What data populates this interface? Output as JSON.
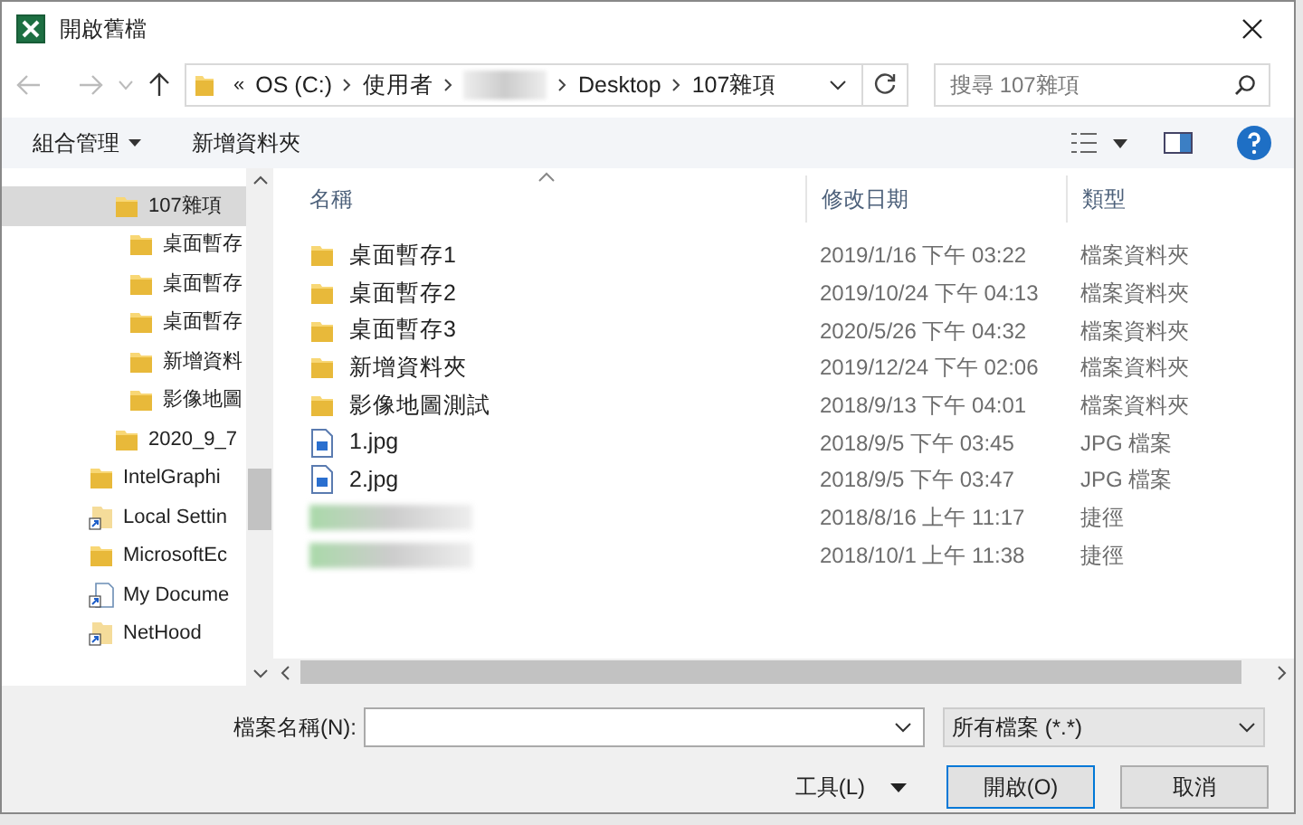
{
  "window": {
    "title": "開啟舊檔"
  },
  "address_bar": {
    "overflow": "«",
    "crumbs": [
      {
        "label": "OS (C:)",
        "kind": "text"
      },
      {
        "label": "使用者",
        "kind": "text"
      },
      {
        "kind": "blurred"
      },
      {
        "label": "Desktop",
        "kind": "text"
      },
      {
        "label": "107雜項",
        "kind": "text"
      }
    ]
  },
  "search": {
    "placeholder": "搜尋 107雜項"
  },
  "toolbar": {
    "organize": "組合管理",
    "new_folder": "新增資料夾"
  },
  "sidebar": {
    "desktop_items": [
      {
        "label": "107雜項",
        "kind": "folder",
        "selected": true,
        "children": [
          {
            "label": "桌面暫存",
            "kind": "folder",
            "selected": false
          },
          {
            "label": "桌面暫存",
            "kind": "folder",
            "selected": false
          },
          {
            "label": "桌面暫存",
            "kind": "folder",
            "selected": false
          },
          {
            "label": "新增資料",
            "kind": "folder",
            "selected": false
          },
          {
            "label": "影像地圖",
            "kind": "folder",
            "selected": false
          }
        ]
      },
      {
        "label": "2020_9_7",
        "kind": "folder",
        "selected": false
      }
    ],
    "other_items": [
      {
        "label": "IntelGraphi",
        "kind": "folder",
        "selected": false
      },
      {
        "label": "Local Settin",
        "kind": "shortcut",
        "selected": false
      },
      {
        "label": "MicrosoftEc",
        "kind": "folder",
        "selected": false
      },
      {
        "label": "My Docume",
        "kind": "doc-shortcut",
        "selected": false
      },
      {
        "label": "NetHood",
        "kind": "shortcut",
        "selected": false
      }
    ]
  },
  "table": {
    "columns": [
      "名稱",
      "修改日期",
      "類型"
    ],
    "rows": [
      {
        "kind": "folder",
        "name": "桌面暫存1",
        "date": "2019/1/16 下午 03:22",
        "type": "檔案資料夾"
      },
      {
        "kind": "folder",
        "name": "桌面暫存2",
        "date": "2019/10/24 下午 04:13",
        "type": "檔案資料夾"
      },
      {
        "kind": "folder",
        "name": "桌面暫存3",
        "date": "2020/5/26 下午 04:32",
        "type": "檔案資料夾"
      },
      {
        "kind": "folder",
        "name": "新增資料夾",
        "date": "2019/12/24 下午 02:06",
        "type": "檔案資料夾"
      },
      {
        "kind": "folder",
        "name": "影像地圖測試",
        "date": "2018/9/13 下午 04:01",
        "type": "檔案資料夾"
      },
      {
        "kind": "image",
        "name": "1.jpg",
        "date": "2018/9/5 下午 03:45",
        "type": "JPG 檔案"
      },
      {
        "kind": "image",
        "name": "2.jpg",
        "date": "2018/9/5 下午 03:47",
        "type": "JPG 檔案"
      },
      {
        "kind": "blurred",
        "date": "2018/8/16 上午 11:17",
        "type": "捷徑"
      },
      {
        "kind": "blurred",
        "date": "2018/10/1 上午 11:38",
        "type": "捷徑"
      }
    ]
  },
  "bottom": {
    "filename_label": "檔案名稱(N):",
    "filter": "所有檔案 (*.*)",
    "tools": "工具(L)",
    "open": "開啟(O)",
    "cancel": "取消"
  }
}
